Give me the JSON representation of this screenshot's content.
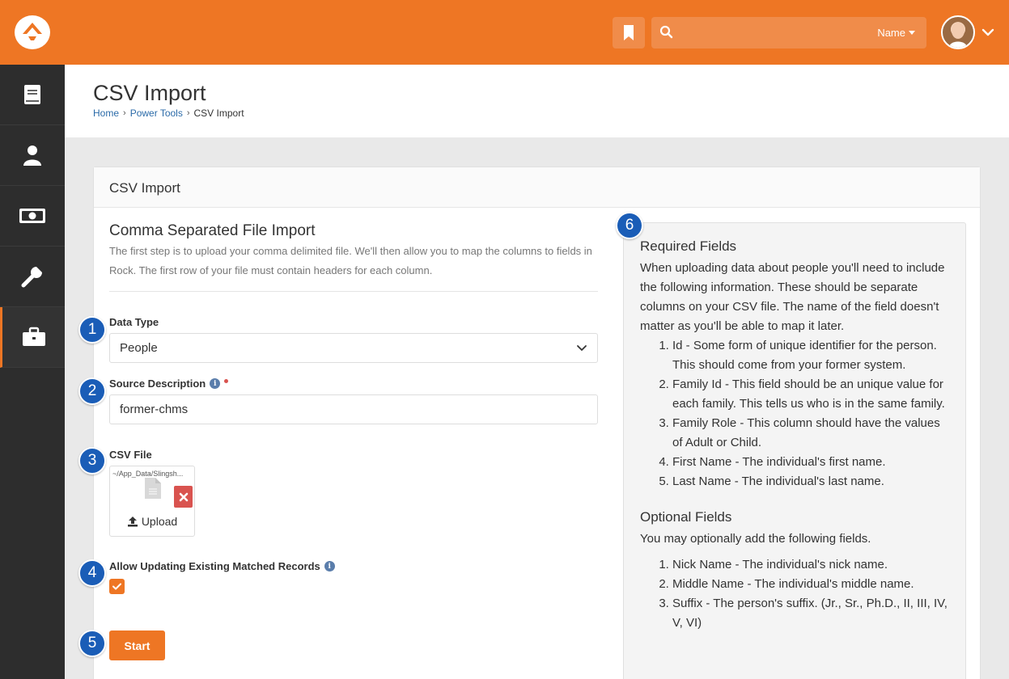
{
  "header": {
    "search_filter": "Name"
  },
  "page": {
    "title": "CSV Import",
    "breadcrumb": [
      {
        "label": "Home"
      },
      {
        "label": "Power Tools"
      },
      {
        "label": "CSV Import"
      }
    ]
  },
  "panel": {
    "heading": "CSV Import",
    "form_title": "Comma Separated File Import",
    "form_description": "The first step is to upload your comma delimited file. We'll then allow you to map the columns to fields in Rock. The first row of your file must contain headers for each column.",
    "data_type": {
      "label": "Data Type",
      "value": "People"
    },
    "source_description": {
      "label": "Source Description",
      "value": "former-chms",
      "info_icon": "i"
    },
    "csv_file": {
      "label": "CSV File",
      "file_path": "~/App_Data/Slingsh...",
      "upload_label": "Upload"
    },
    "allow_updating": {
      "label": "Allow Updating Existing Matched Records",
      "info_icon": "i",
      "checked": true
    },
    "start_button": "Start"
  },
  "callouts": [
    "1",
    "2",
    "3",
    "4",
    "5",
    "6"
  ],
  "help": {
    "required_title": "Required Fields",
    "required_intro": "When uploading data about people you'll need to include the following information. These should be separate columns on your CSV file. The name of the field doesn't matter as you'll be able to map it later.",
    "required_items": [
      "Id - Some form of unique identifier for the person. This should come from your former system.",
      "Family Id - This field should be an unique value for each family. This tells us who is in the same family.",
      "Family Role - This column should have the values of Adult or Child.",
      "First Name - The individual's first name.",
      "Last Name - The individual's last name."
    ],
    "optional_title": "Optional Fields",
    "optional_intro": "You may optionally add the following fields.",
    "optional_items": [
      "Nick Name - The individual's nick name.",
      "Middle Name - The individual's middle name.",
      "Suffix - The person's suffix. (Jr., Sr., Ph.D., II, III, IV, V, VI)"
    ]
  },
  "colors": {
    "brand": "#ee7624",
    "sidebar": "#2d2d2d",
    "callout": "#1a5db7",
    "link": "#2a6aa8",
    "danger": "#d9534f"
  },
  "icons": [
    "rock-logo-icon",
    "bookmark-icon",
    "search-icon",
    "chevron-down-icon",
    "book-icon",
    "person-icon",
    "money-icon",
    "wrench-icon",
    "briefcase-icon",
    "info-icon",
    "document-icon",
    "remove-icon",
    "upload-icon",
    "check-icon"
  ]
}
